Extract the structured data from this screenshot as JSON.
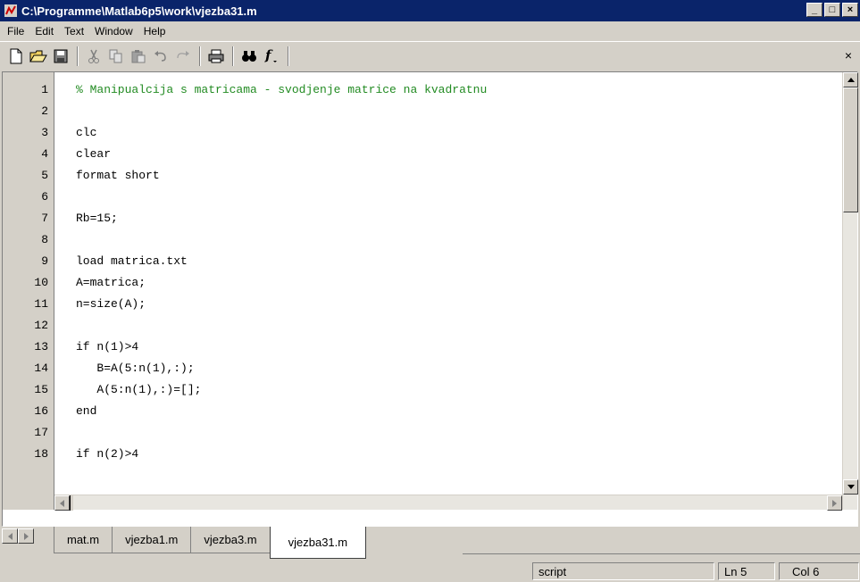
{
  "window": {
    "title": "C:\\Programme\\Matlab6p5\\work\\vjezba31.m",
    "minimize": "_",
    "maximize": "□",
    "close": "×"
  },
  "menu": [
    "File",
    "Edit",
    "Text",
    "Window",
    "Help"
  ],
  "toolbar": {
    "items": [
      "new-file-icon",
      "open-file-icon",
      "save-icon",
      "cut-icon",
      "copy-icon",
      "paste-icon",
      "undo-icon",
      "redo-icon",
      "print-icon",
      "find-icon",
      "function-icon"
    ],
    "close_doc": "×"
  },
  "editor": {
    "line_numbers": [
      "1",
      "2",
      "3",
      "4",
      "5",
      "6",
      "7",
      "8",
      "9",
      "10",
      "11",
      "12",
      "13",
      "14",
      "15",
      "16",
      "17",
      "18"
    ],
    "lines": [
      "% Manipualcija s matricama - svodjenje matrice na kvadratnu",
      "",
      "clc",
      "clear",
      "format short",
      "",
      "Rb=15;",
      "",
      "load matrica.txt",
      "A=matrica;",
      "n=size(A);",
      "",
      "if n(1)>4",
      "   B=A(5:n(1),:);",
      "   A(5:n(1),:)=[];",
      "end",
      "",
      "if n(2)>4"
    ]
  },
  "tabs": [
    "mat.m",
    "vjezba1.m",
    "vjezba3.m",
    "vjezba31.m"
  ],
  "active_tab": "vjezba31.m",
  "status": {
    "mode": "script",
    "line": "Ln 5",
    "col": "Col 6"
  }
}
